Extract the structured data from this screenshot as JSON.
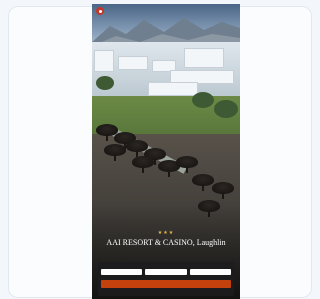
{
  "brand": {
    "logo_icon": "brand-logo-icon",
    "accent": "#c0392b"
  },
  "nav": {
    "items": [
      "",
      "",
      "",
      ""
    ]
  },
  "hotel": {
    "stars": "★★★",
    "name": "AAI RESORT & CASINO, Laughlin",
    "subtitle": ""
  },
  "booking": {
    "fields": [
      {
        "label": "",
        "value": ""
      },
      {
        "label": "",
        "value": ""
      },
      {
        "label": "",
        "value": ""
      }
    ],
    "search_label": "",
    "button_color": "#c2410c"
  }
}
